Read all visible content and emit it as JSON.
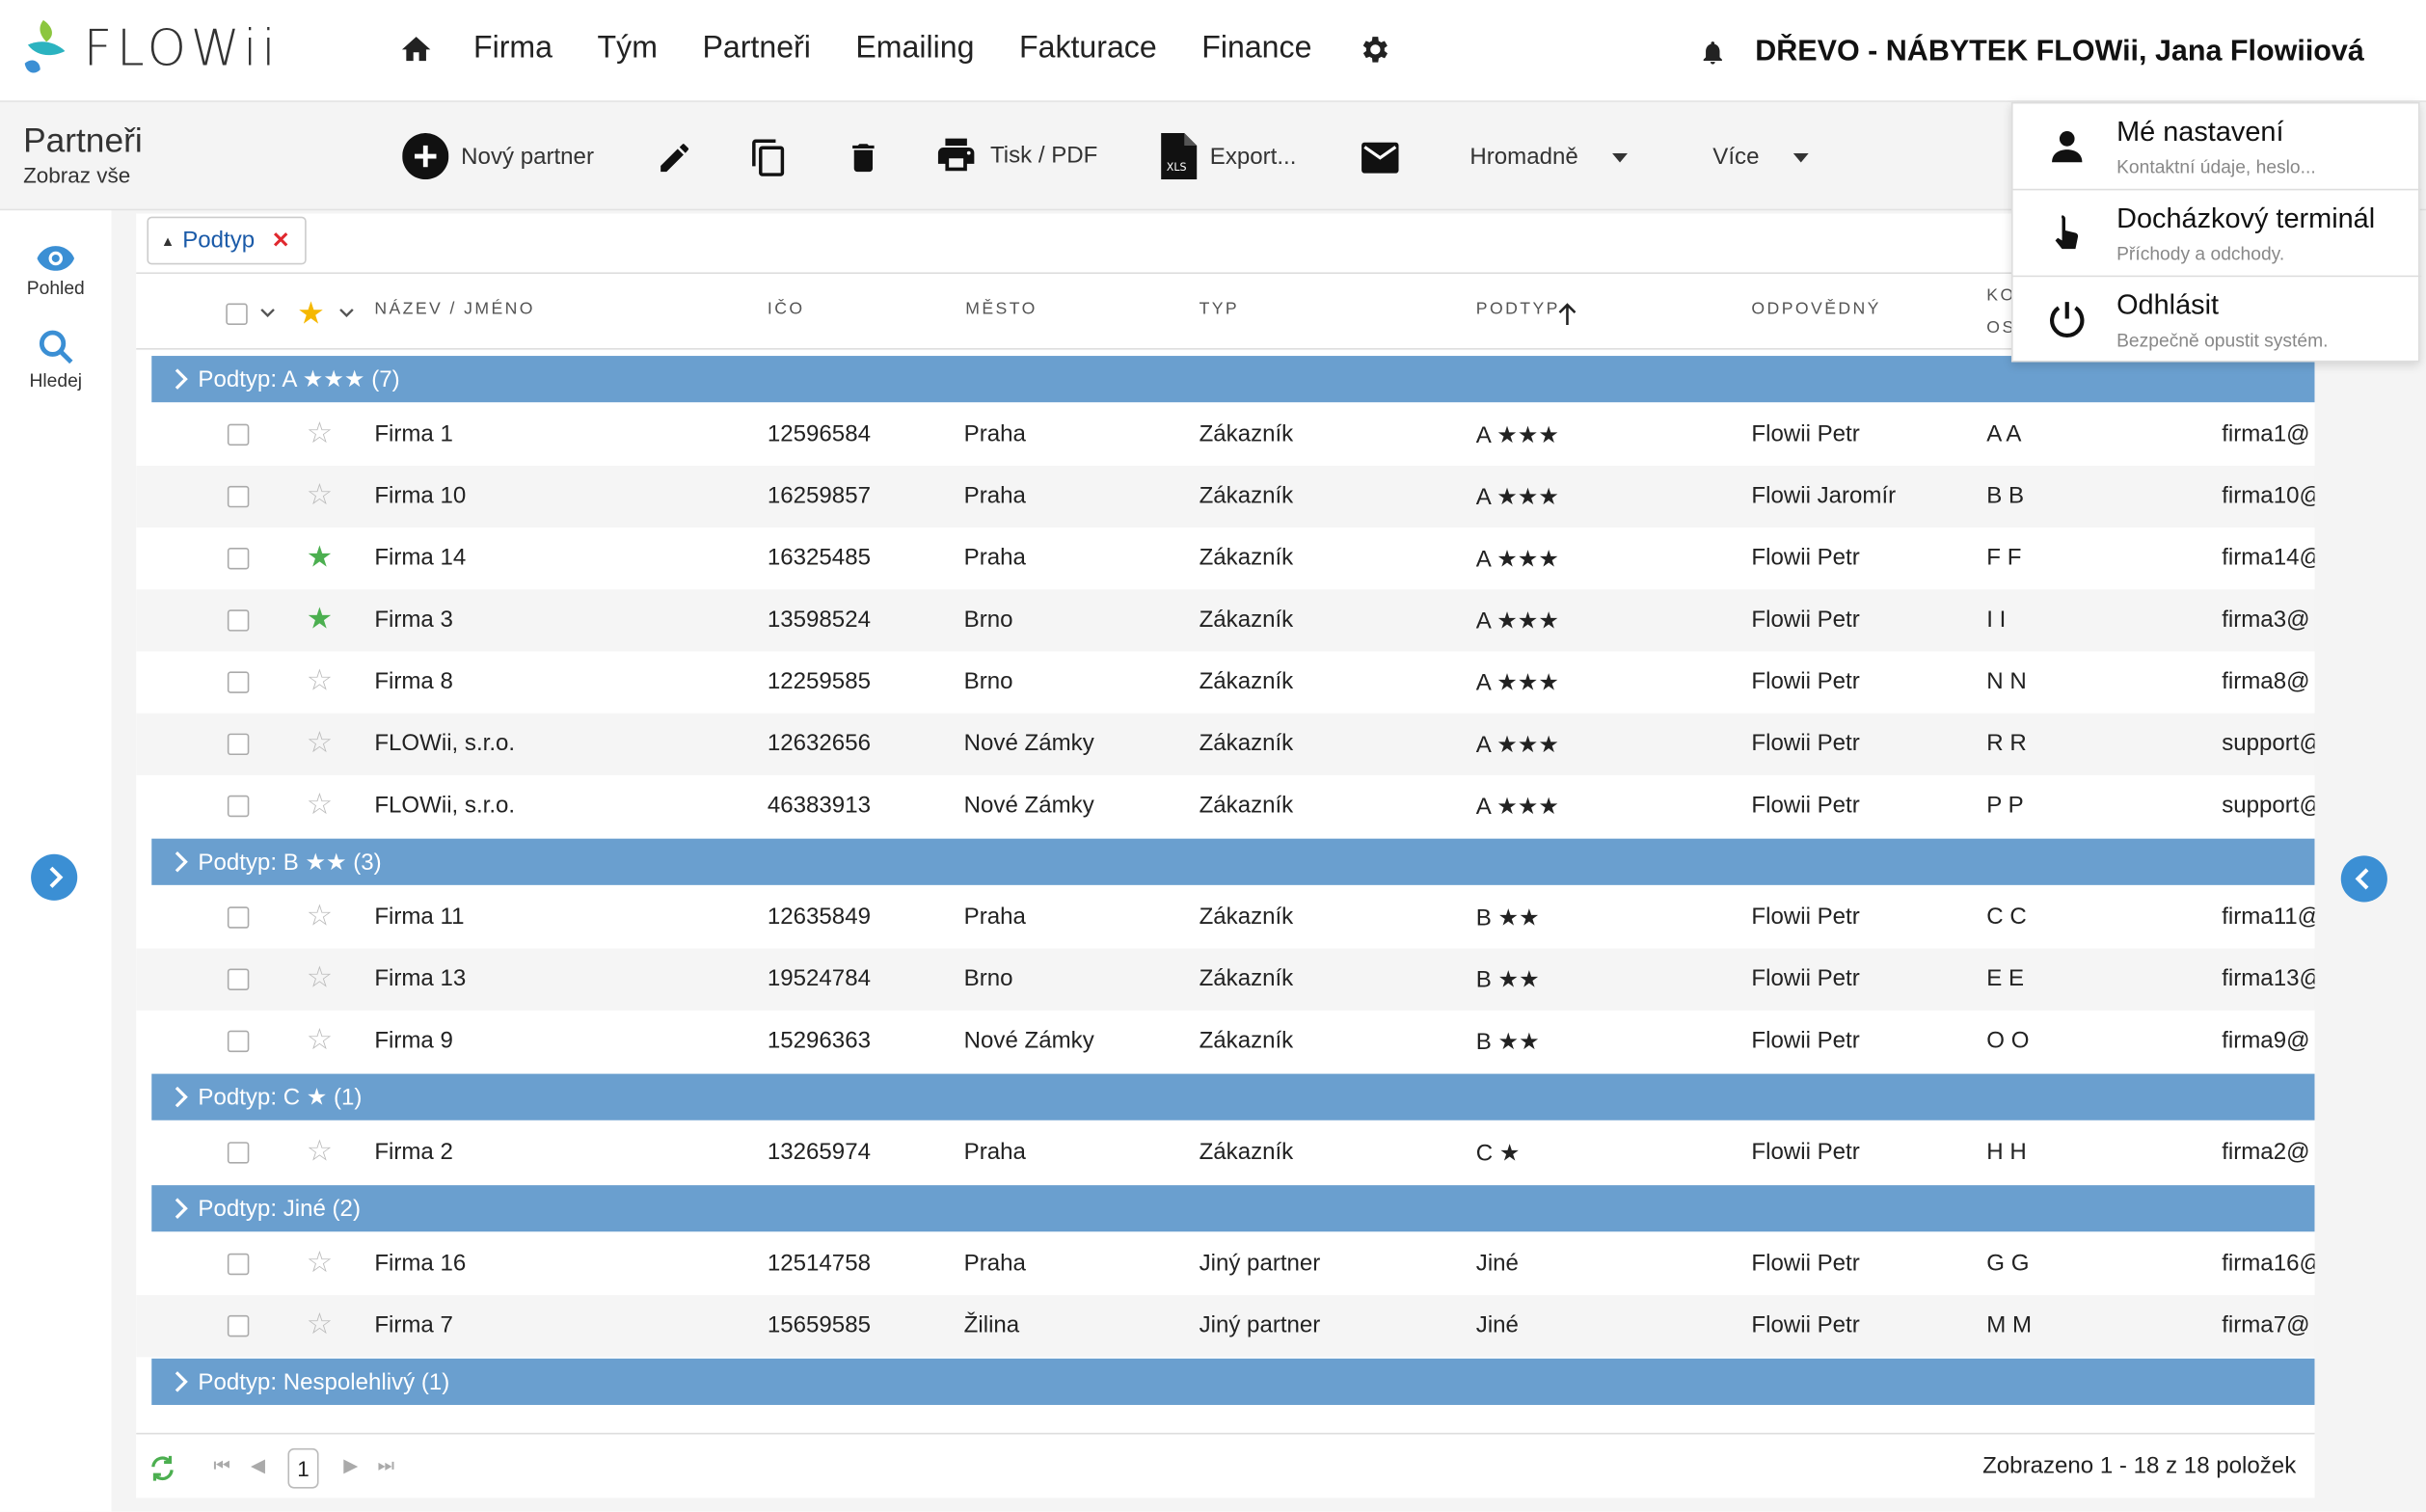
{
  "brand": {
    "name": "FLOWii",
    "colors": {
      "accent": "#3b8fd4",
      "group": "#6a9fcf",
      "star_on": "#4caf50",
      "star_head": "#f5b800",
      "remove": "#e0282e"
    }
  },
  "nav": {
    "items": [
      "Firma",
      "Tým",
      "Partneři",
      "Emailing",
      "Fakturace",
      "Finance"
    ]
  },
  "header": {
    "company": "DŘEVO - NÁBYTEK FLOWii, Jana Flowiiová"
  },
  "page": {
    "title": "Partneři",
    "subtitle": "Zobraz vše"
  },
  "toolbar": {
    "new_label": "Nový partner",
    "print_label": "Tisk / PDF",
    "export_label": "Export...",
    "bulk_label": "Hromadně",
    "more_label": "Více"
  },
  "rail": {
    "view_label": "Pohled",
    "search_label": "Hledej"
  },
  "filter_chip": {
    "label": "Podtyp"
  },
  "columns": {
    "name": "NÁZEV / JMÉNO",
    "ico": "IČO",
    "city": "MĚSTO",
    "type": "TYP",
    "subtype": "PODTYP",
    "owner": "ODPOVĚDNÝ",
    "contact_a": "KO",
    "contact_b": "OS"
  },
  "groups": [
    {
      "label": "Podtyp: A ★★★ (7)",
      "rows": [
        {
          "name": "Firma 1",
          "ico": "12596584",
          "city": "Praha",
          "type": "Zákazník",
          "subtype": "A ★★★",
          "owner": "Flowii Petr",
          "contact": "A A",
          "email": "firma1@",
          "fav": false
        },
        {
          "name": "Firma 10",
          "ico": "16259857",
          "city": "Praha",
          "type": "Zákazník",
          "subtype": "A ★★★",
          "owner": "Flowii Jaromír",
          "contact": "B B",
          "email": "firma10@",
          "fav": false
        },
        {
          "name": "Firma 14",
          "ico": "16325485",
          "city": "Praha",
          "type": "Zákazník",
          "subtype": "A ★★★",
          "owner": "Flowii Petr",
          "contact": "F F",
          "email": "firma14@",
          "fav": true
        },
        {
          "name": "Firma 3",
          "ico": "13598524",
          "city": "Brno",
          "type": "Zákazník",
          "subtype": "A ★★★",
          "owner": "Flowii Petr",
          "contact": "I I",
          "email": "firma3@",
          "fav": true
        },
        {
          "name": "Firma 8",
          "ico": "12259585",
          "city": "Brno",
          "type": "Zákazník",
          "subtype": "A ★★★",
          "owner": "Flowii Petr",
          "contact": "N N",
          "email": "firma8@",
          "fav": false
        },
        {
          "name": "FLOWii, s.r.o.",
          "ico": "12632656",
          "city": "Nové Zámky",
          "type": "Zákazník",
          "subtype": "A ★★★",
          "owner": "Flowii Petr",
          "contact": "R R",
          "email": "support@",
          "fav": false
        },
        {
          "name": "FLOWii, s.r.o.",
          "ico": "46383913",
          "city": "Nové Zámky",
          "type": "Zákazník",
          "subtype": "A ★★★",
          "owner": "Flowii Petr",
          "contact": "P P",
          "email": "support@",
          "fav": false
        }
      ]
    },
    {
      "label": "Podtyp: B ★★ (3)",
      "rows": [
        {
          "name": "Firma 11",
          "ico": "12635849",
          "city": "Praha",
          "type": "Zákazník",
          "subtype": "B ★★",
          "owner": "Flowii Petr",
          "contact": "C C",
          "email": "firma11@",
          "fav": false
        },
        {
          "name": "Firma 13",
          "ico": "19524784",
          "city": "Brno",
          "type": "Zákazník",
          "subtype": "B ★★",
          "owner": "Flowii Petr",
          "contact": "E E",
          "email": "firma13@",
          "fav": false
        },
        {
          "name": "Firma 9",
          "ico": "15296363",
          "city": "Nové Zámky",
          "type": "Zákazník",
          "subtype": "B ★★",
          "owner": "Flowii Petr",
          "contact": "O O",
          "email": "firma9@",
          "fav": false
        }
      ]
    },
    {
      "label": "Podtyp: C ★ (1)",
      "rows": [
        {
          "name": "Firma 2",
          "ico": "13265974",
          "city": "Praha",
          "type": "Zákazník",
          "subtype": "C ★",
          "owner": "Flowii Petr",
          "contact": "H H",
          "email": "firma2@",
          "fav": false
        }
      ]
    },
    {
      "label": "Podtyp: Jiné (2)",
      "rows": [
        {
          "name": "Firma 16",
          "ico": "12514758",
          "city": "Praha",
          "type": "Jiný partner",
          "subtype": "Jiné",
          "owner": "Flowii Petr",
          "contact": "G G",
          "email": "firma16@",
          "fav": false
        },
        {
          "name": "Firma 7",
          "ico": "15659585",
          "city": "Žilina",
          "type": "Jiný partner",
          "subtype": "Jiné",
          "owner": "Flowii Petr",
          "contact": "M M",
          "email": "firma7@",
          "fav": false
        }
      ]
    },
    {
      "label": "Podtyp: Nespolehlivý (1)",
      "rows": []
    }
  ],
  "footer": {
    "page": "1",
    "summary": "Zobrazeno 1 - 18 z 18 položek"
  },
  "user_menu": [
    {
      "title": "Mé nastavení",
      "subtitle": "Kontaktní údaje, heslo...",
      "icon": "person-icon"
    },
    {
      "title": "Docházkový terminál",
      "subtitle": "Příchody a odchody.",
      "icon": "touch-icon"
    },
    {
      "title": "Odhlásit",
      "subtitle": "Bezpečně opustit systém.",
      "icon": "power-icon"
    }
  ]
}
